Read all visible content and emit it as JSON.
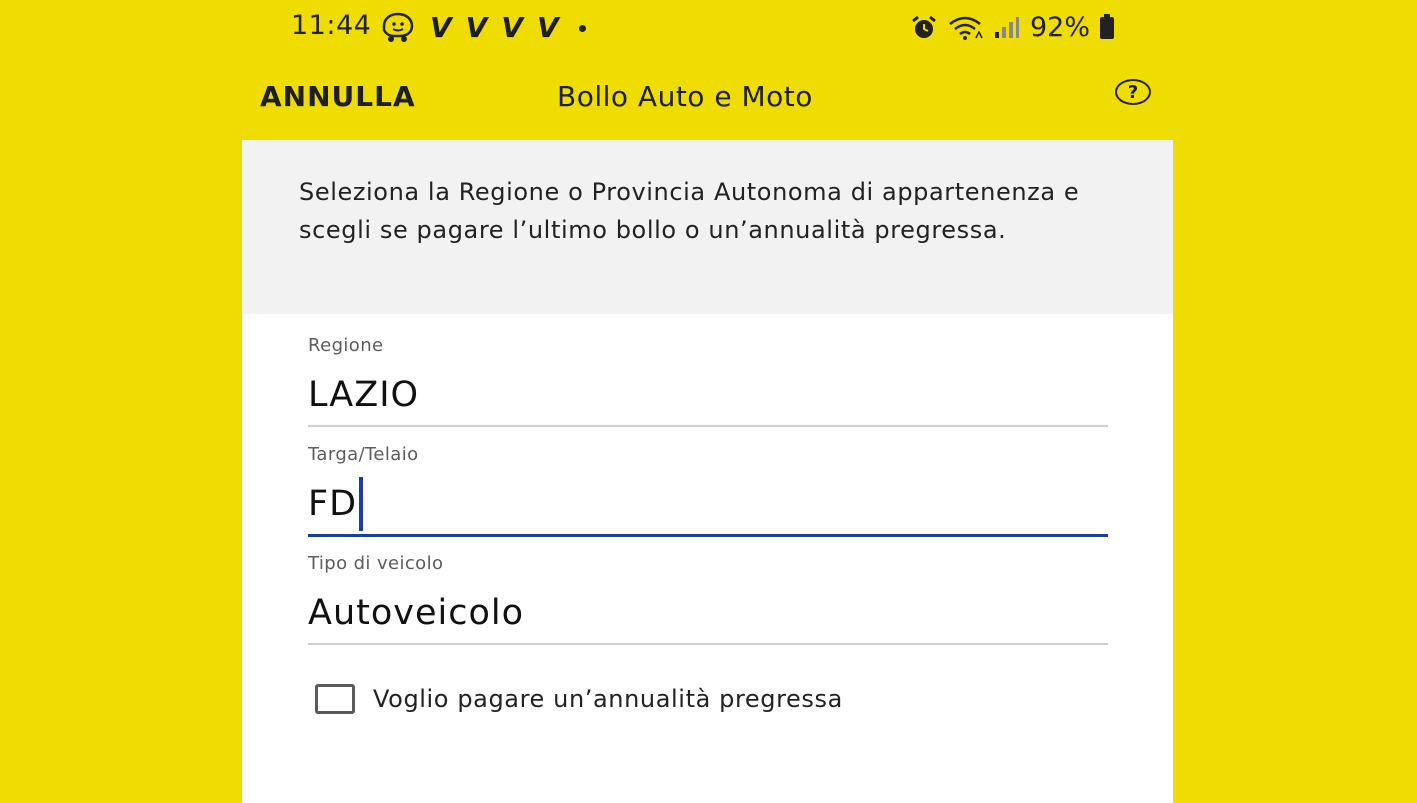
{
  "status_bar": {
    "time": "11:44",
    "icons": [
      "waze-icon",
      "v-app-icon",
      "v-app-icon",
      "v-app-icon",
      "v-app-icon",
      "notification-dot-icon"
    ],
    "right_icons": [
      "alarm-icon",
      "wifi-icon",
      "signal-icon"
    ],
    "battery": "92%"
  },
  "header": {
    "cancel_label": "ANNULLA",
    "title": "Bollo Auto e Moto",
    "help_icon": "help-circle-icon",
    "help_label": "?"
  },
  "intro": {
    "text": "Seleziona la Regione o Provincia Autonoma di appartenenza e scegli se pagare l’ultimo bollo o un’annualità pregressa."
  },
  "form": {
    "region": {
      "label": "Regione",
      "value": "LAZIO"
    },
    "plate": {
      "label": "Targa/Telaio",
      "value": "FD"
    },
    "vehicle_type": {
      "label": "Tipo di veicolo",
      "value": "Autoveicolo"
    },
    "past_year_checkbox": {
      "label": "Voglio pagare un’annualità pregressa",
      "checked": false
    }
  },
  "colors": {
    "background": "#efdc00",
    "accent": "#1a3e9e",
    "panel": "#ffffff",
    "intro_bg": "#f2f2f2"
  }
}
